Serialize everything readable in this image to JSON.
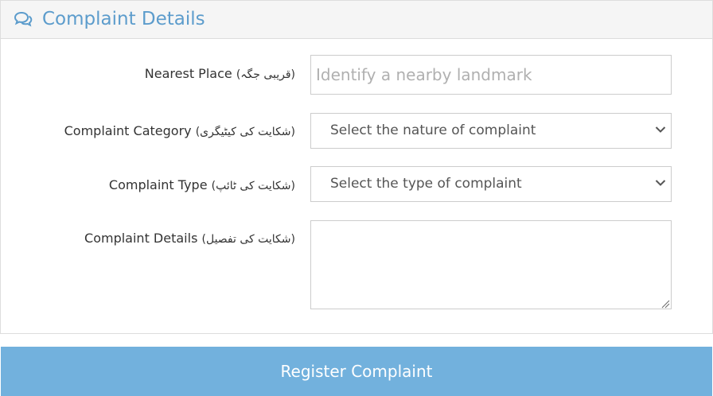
{
  "panel": {
    "title": "Complaint Details",
    "title_icon": "comments-icon",
    "accent_color": "#5c9ccc"
  },
  "form": {
    "nearest_place": {
      "label_en": "Nearest Place",
      "label_ur": "(قریبی جگہ)",
      "placeholder": "Identify a nearby landmark",
      "value": ""
    },
    "complaint_category": {
      "label_en": "Complaint Category",
      "label_ur": "(شکایت کی کیٹیگری)",
      "selected": "Select the nature of complaint",
      "icon": "chevron-down-icon"
    },
    "complaint_type": {
      "label_en": "Complaint Type",
      "label_ur": "(شکایت کی ٹائپ)",
      "selected": "Select the type of complaint",
      "icon": "chevron-down-icon"
    },
    "complaint_details": {
      "label_en": "Complaint Details",
      "label_ur": "(شکایت کی تفصیل)",
      "value": ""
    }
  },
  "submit": {
    "label": "Register Complaint",
    "color": "#72b1dd"
  }
}
